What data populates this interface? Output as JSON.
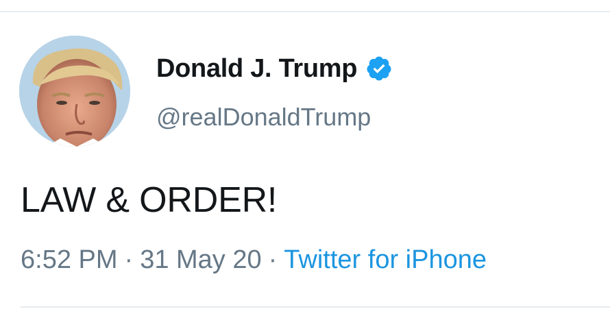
{
  "tweet": {
    "author": {
      "display_name": "Donald J. Trump",
      "handle": "@realDonaldTrump",
      "verified": true,
      "avatar_icon": "avatar-photo"
    },
    "text": "LAW & ORDER!",
    "time": "6:52 PM",
    "date": "31 May 20",
    "separator": "·",
    "source": "Twitter for iPhone"
  },
  "colors": {
    "name_text": "#14171a",
    "secondary_text": "#657786",
    "link": "#1b95e0",
    "verified_badge": "#1da1f2",
    "divider": "#e6ecf0"
  }
}
